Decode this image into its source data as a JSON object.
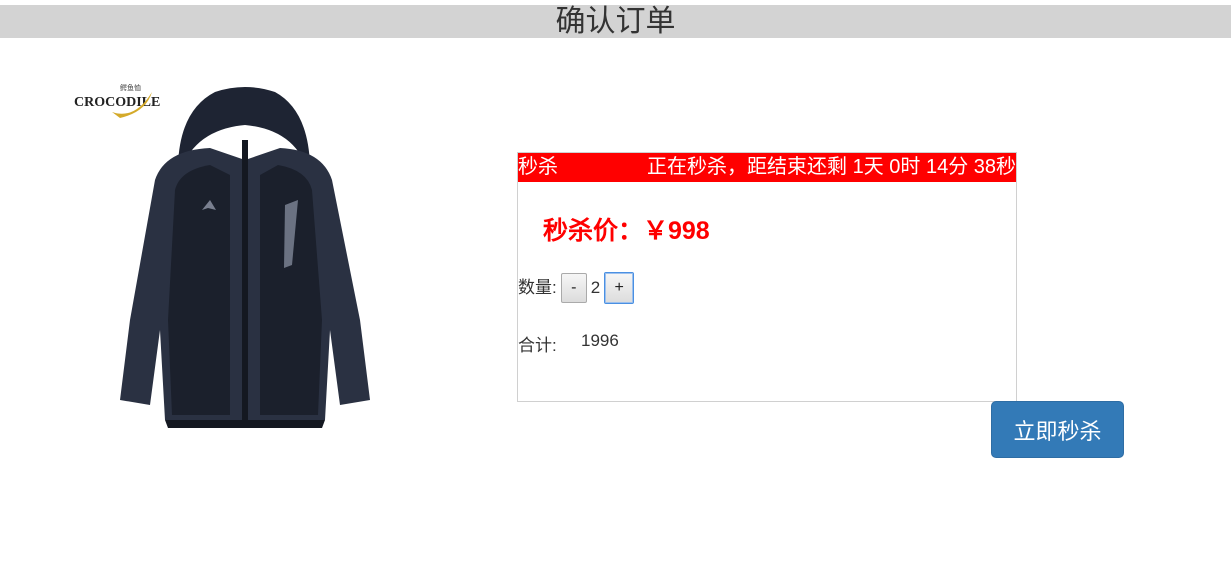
{
  "page": {
    "title": "确认订单"
  },
  "product": {
    "logo_brand": "CROCODILE",
    "logo_chinese": "鳄鱼恤"
  },
  "seckill": {
    "tag": "秒杀",
    "countdown_text": "正在秒杀，距结束还剩 1天 0时 14分 38秒",
    "price_label": "秒杀价：￥998",
    "quantity_label": "数量:",
    "minus_label": "-",
    "quantity_value": "2",
    "plus_label": "+",
    "total_label": "合计:",
    "total_value": "1996"
  },
  "actions": {
    "buy_now": "立即秒杀"
  },
  "colors": {
    "header_bg": "#d3d3d3",
    "banner_bg": "#ff0000",
    "price_color": "#ff0000",
    "button_primary": "#337ab7"
  }
}
